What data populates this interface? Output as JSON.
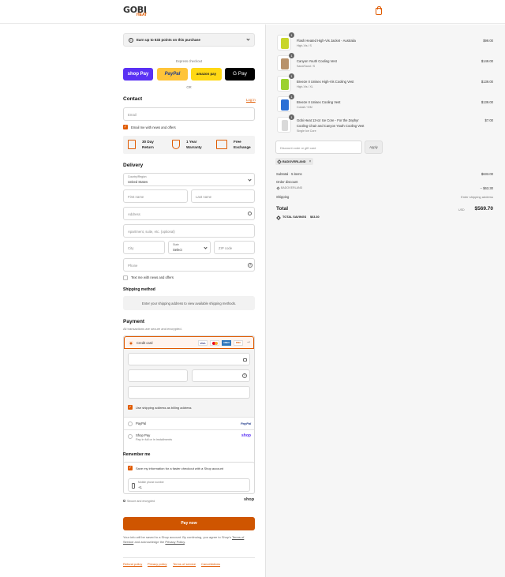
{
  "brand": {
    "name_top": "GOBI",
    "name_bottom": "HEAT"
  },
  "points_banner": {
    "text": "Earn up to 633 points on this purchase"
  },
  "express": {
    "label": "Express checkout",
    "shop_pay": "shop Pay",
    "paypal": "PayPal",
    "amazon_pay": "amazon pay",
    "gpay": "G Pay",
    "or": "OR"
  },
  "contact": {
    "title": "Contact",
    "login": "Log in",
    "email_placeholder": "Email",
    "email_news": "Email me with news and offers"
  },
  "perks": [
    {
      "icon": "calendar-return-icon",
      "line1": "30 Day",
      "line2": "Return"
    },
    {
      "icon": "shield-warranty-icon",
      "line1": "1 Year",
      "line2": "Warranty"
    },
    {
      "icon": "box-exchange-icon",
      "line1": "Free",
      "line2": "Exchange"
    }
  ],
  "delivery": {
    "title": "Delivery",
    "country_label": "Country/Region",
    "country_value": "United States",
    "first_name": "First name",
    "last_name": "Last name",
    "address": "Address",
    "apartment": "Apartment, suite, etc. (optional)",
    "city": "City",
    "state_label": "State",
    "state_value": "Select",
    "zip": "ZIP code",
    "phone": "Phone",
    "text_news": "Text me with news and offers"
  },
  "shipping": {
    "title": "Shipping method",
    "notice": "Enter your shipping address to view available shipping methods."
  },
  "payment": {
    "title": "Payment",
    "subtitle": "All transactions are secure and encrypted.",
    "credit_card": "Credit card",
    "card_brands": [
      "VISA",
      "MC",
      "AMEX",
      "DISC"
    ],
    "billing_same": "Use shipping address as billing address",
    "paypal_label": "PayPal",
    "paypal_logo": "PayPal",
    "shoppay_label": "Shop Pay",
    "shoppay_sub": "Pay in full or in installments",
    "shoppay_logo": "shop"
  },
  "remember": {
    "title": "Remember me",
    "save_info": "Save my information for a faster checkout with a Shop account",
    "mobile_label": "Mobile phone number",
    "mobile_value": "+1",
    "secure": "Secure and encrypted",
    "shop_logo": "shop"
  },
  "pay_button": "Pay now",
  "terms": {
    "prefix": "Your info will be saved to a Shop account. By continuing, you agree to Shop's",
    "terms_link": "Terms of Service",
    "middle": "and acknowledge the",
    "privacy_link": "Privacy Policy",
    "suffix": "."
  },
  "footer_links": [
    "Refund policy",
    "Privacy policy",
    "Terms of service",
    "Cancellations"
  ],
  "cart": {
    "items": [
      {
        "qty": "1",
        "name": "Flash Heated High-Vis Jacket - Australia",
        "variant": "High-Vis / S",
        "price": "$99.00",
        "color": "#c8d62a"
      },
      {
        "qty": "1",
        "name": "Canyon Youth Cooling Vest",
        "variant": "Sand/Sand / S",
        "price": "$149.00",
        "color": "#b8926a"
      },
      {
        "qty": "1",
        "name": "Breeze II Unisex High-Vis Cooling Vest",
        "variant": "High-Vis / XL",
        "price": "$139.00",
        "color": "#9bd12f"
      },
      {
        "qty": "1",
        "name": "Breeze II Unisex Cooling Vest",
        "variant": "Cobalt / S/M",
        "price": "$139.00",
        "color": "#2a6fd6"
      },
      {
        "qty": "1",
        "name": "Gobi Heat 13-oz Ice Core - For the Zephyr Cooling Chair and Canyon Youth Cooling Vest",
        "variant": "Single Ice Core",
        "price": "$7.00",
        "color": "#d9d9d9"
      }
    ],
    "discount_placeholder": "Discount code or gift card",
    "apply": "Apply",
    "applied_code": "BADOVERLAND",
    "subtotal_label": "Subtotal · 5 items",
    "subtotal_value": "$633.00",
    "order_discount_label": "Order discount",
    "order_discount_code": "BADOVERLAND",
    "order_discount_value": "− $63.30",
    "shipping_label": "Shipping",
    "shipping_value": "Enter shipping address",
    "total_label": "Total",
    "total_currency": "USD",
    "total_value": "$569.70",
    "savings_label": "TOTAL SAVINGS",
    "savings_value": "$63.30"
  },
  "colors": {
    "accent": "#e05a00",
    "shop_pay": "#5a31f4",
    "paypal": "#ffc439",
    "amazon": "#ffd814"
  }
}
